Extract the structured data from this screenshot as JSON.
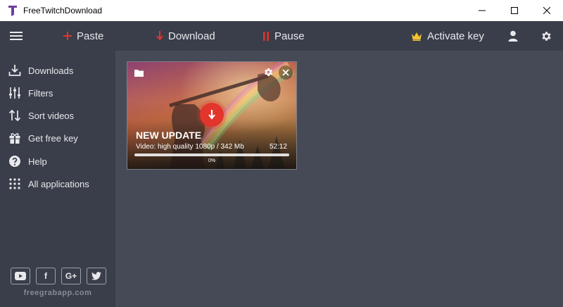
{
  "window": {
    "title": "FreeTwitchDownload",
    "logo_color": "#6b3fa0"
  },
  "toolbar": {
    "paste_label": "Paste",
    "download_label": "Download",
    "pause_label": "Pause",
    "activate_label": "Activate key",
    "accent_red": "#e2352b",
    "crown_color": "#f2c230"
  },
  "sidebar": {
    "items": [
      {
        "label": "Downloads",
        "icon": "download-icon"
      },
      {
        "label": "Filters",
        "icon": "sliders-icon"
      },
      {
        "label": "Sort videos",
        "icon": "sort-icon"
      },
      {
        "label": "Get free key",
        "icon": "gift-icon"
      },
      {
        "label": "Help",
        "icon": "help-icon"
      },
      {
        "label": "All applications",
        "icon": "grid-icon"
      }
    ],
    "social": [
      {
        "icon": "youtube-icon"
      },
      {
        "label": "f",
        "icon": "facebook-icon"
      },
      {
        "label": "G+",
        "icon": "google-plus-icon"
      },
      {
        "icon": "twitter-icon"
      }
    ],
    "site": "freegrabapp.com"
  },
  "video": {
    "title": "NEW UPDATE",
    "info": "Video: high quality 1080p / 342 Mb",
    "duration": "52:12",
    "progress_label": "0%",
    "progress_value": 0
  }
}
